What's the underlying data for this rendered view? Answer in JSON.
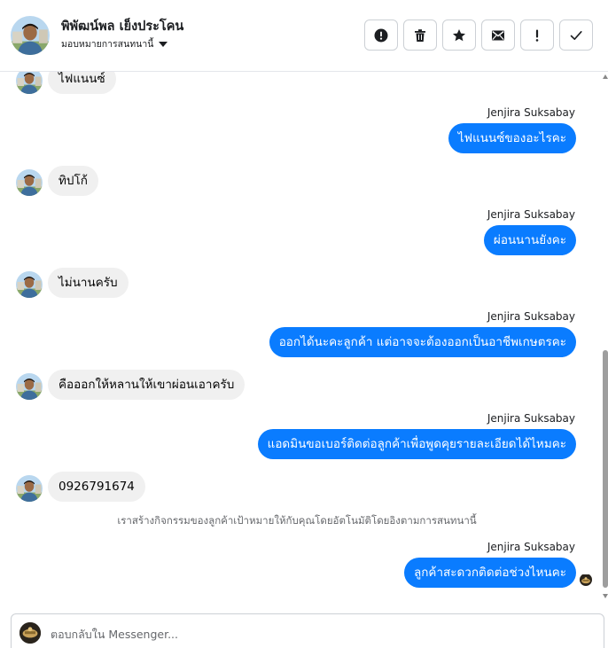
{
  "header": {
    "contact_name": "พิพัฒน์พล เย็งประโคน",
    "assign_label": "มอบหมายการสนทนานี้",
    "actions": [
      {
        "name": "spam-button",
        "icon": "alert-circle-icon"
      },
      {
        "name": "delete-button",
        "icon": "trash-icon"
      },
      {
        "name": "star-button",
        "icon": "star-icon"
      },
      {
        "name": "mark-unread-button",
        "icon": "envelope-icon"
      },
      {
        "name": "follow-up-button",
        "icon": "exclamation-icon"
      },
      {
        "name": "mark-done-button",
        "icon": "check-icon"
      }
    ]
  },
  "thread": {
    "messages": [
      {
        "direction": "in",
        "text": "ไฟแนนซ์"
      },
      {
        "direction": "out",
        "sender": "Jenjira Suksabay",
        "text": "ไฟแนนซ์ของอะไรคะ"
      },
      {
        "direction": "in",
        "text": "ทิปโก้"
      },
      {
        "direction": "out",
        "sender": "Jenjira Suksabay",
        "text": "ผ่อนนานยังคะ"
      },
      {
        "direction": "in",
        "text": "ไม่นานครับ"
      },
      {
        "direction": "out",
        "sender": "Jenjira Suksabay",
        "text": "ออกได้นะคะลูกค้า แต่อาจจะต้องออกเป็นอาชีพเกษตรคะ"
      },
      {
        "direction": "in",
        "text": "คือออกให้หลานให้เขาผ่อนเอาครับ"
      },
      {
        "direction": "out",
        "sender": "Jenjira Suksabay",
        "text": "แอดมินขอเบอร์ติดต่อลูกค้าเพื่อพูดคุยรายละเอียดได้ไหมคะ"
      },
      {
        "direction": "in",
        "text": "0926791674"
      },
      {
        "direction": "out",
        "sender": "Jenjira Suksabay",
        "text": "ลูกค้าสะดวกติดต่อช่วงไหนคะ"
      }
    ],
    "system_note": "เราสร้างกิจกรรมของลูกค้าเป้าหมายให้กับคุณโดยอัตโนมัติโดยอิงตามการสนทนานี้"
  },
  "composer": {
    "placeholder": "ตอบกลับใน Messenger..."
  },
  "colors": {
    "outgoing_bubble": "#0a7cff",
    "incoming_bubble": "#f0f0f0",
    "muted_text": "#65676b"
  }
}
